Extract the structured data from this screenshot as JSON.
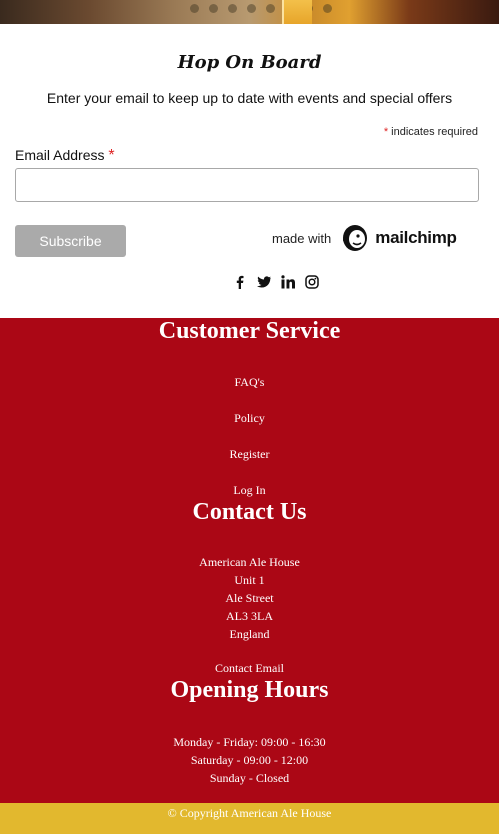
{
  "signup": {
    "title": "Hop On Board",
    "subtitle": "Enter your email to keep up to date with events and special offers",
    "required_star": "*",
    "required_note": "indicates required",
    "email_label": "Email Address",
    "email_value": "",
    "subscribe_label": "Subscribe",
    "made_with": "made with",
    "mailchimp_brand": "mailchimp"
  },
  "social": [
    "facebook-icon",
    "twitter-icon",
    "linkedin-icon",
    "instagram-icon"
  ],
  "footer": {
    "customer_service": {
      "title": "Customer Service",
      "links": [
        "FAQ's",
        "Policy",
        "Register",
        "Log In"
      ]
    },
    "contact": {
      "title": "Contact Us",
      "address": [
        "American Ale House",
        "Unit 1",
        "Ale Street",
        "AL3 3LA",
        "England"
      ],
      "email_link": "Contact Email"
    },
    "hours": {
      "title": "Opening Hours",
      "lines": [
        "Monday - Friday: 09:00 - 16:30",
        "Saturday - 09:00 - 12:00",
        "Sunday - Closed"
      ]
    }
  },
  "copyright": "© Copyright American Ale House",
  "colors": {
    "footer_bg": "#ab0715",
    "copyright_bg": "#e2b82e",
    "button_bg": "#aaaaaa",
    "required": "#dd2222"
  }
}
